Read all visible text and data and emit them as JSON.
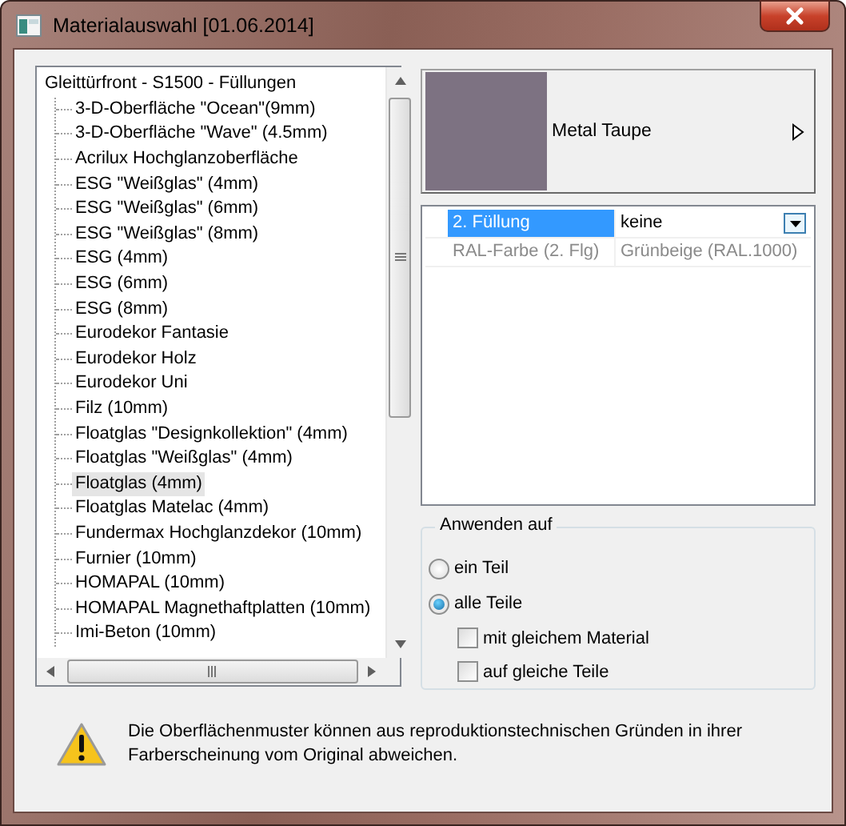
{
  "window": {
    "title": "Materialauswahl [01.06.2014]"
  },
  "tree": {
    "root": "Gleittürfront - S1500 - Füllungen",
    "children": [
      {
        "label": "3-D-Oberfläche \"Ocean\"(9mm)",
        "selected": false
      },
      {
        "label": "3-D-Oberfläche \"Wave\" (4.5mm)",
        "selected": false
      },
      {
        "label": "Acrilux Hochglanzoberfläche",
        "selected": false
      },
      {
        "label": "ESG \"Weißglas\" (4mm)",
        "selected": false
      },
      {
        "label": "ESG \"Weißglas\" (6mm)",
        "selected": false
      },
      {
        "label": "ESG \"Weißglas\" (8mm)",
        "selected": false
      },
      {
        "label": "ESG (4mm)",
        "selected": false
      },
      {
        "label": "ESG (6mm)",
        "selected": false
      },
      {
        "label": "ESG (8mm)",
        "selected": false
      },
      {
        "label": "Eurodekor Fantasie",
        "selected": false
      },
      {
        "label": "Eurodekor Holz",
        "selected": false
      },
      {
        "label": "Eurodekor Uni",
        "selected": false
      },
      {
        "label": "Filz (10mm)",
        "selected": false
      },
      {
        "label": "Floatglas \"Designkollektion\" (4mm)",
        "selected": false
      },
      {
        "label": "Floatglas \"Weißglas\" (4mm)",
        "selected": false
      },
      {
        "label": "Floatglas (4mm)",
        "selected": true
      },
      {
        "label": "Floatglas Matelac (4mm)",
        "selected": false
      },
      {
        "label": "Fundermax Hochglanzdekor (10mm)",
        "selected": false
      },
      {
        "label": "Furnier (10mm)",
        "selected": false
      },
      {
        "label": "HOMAPAL (10mm)",
        "selected": false
      },
      {
        "label": "HOMAPAL Magnethaftplatten (10mm)",
        "selected": false
      },
      {
        "label": "Imi-Beton (10mm)",
        "selected": false
      }
    ]
  },
  "material": {
    "name": "Metal Taupe",
    "color": "#7d7282"
  },
  "properties": [
    {
      "name": "2. Füllung",
      "value": "keine",
      "kind": "dropdown",
      "selected": true,
      "disabled": false
    },
    {
      "name": "RAL-Farbe (2. Flg)",
      "value": "Grünbeige (RAL.1000)",
      "kind": "text",
      "selected": false,
      "disabled": true
    }
  ],
  "apply": {
    "title": "Anwenden auf",
    "options": [
      {
        "label": "ein Teil",
        "kind": "radio",
        "selected": false
      },
      {
        "label": "alle Teile",
        "kind": "radio",
        "selected": true
      },
      {
        "label": "mit gleichem Material",
        "kind": "checkbox",
        "checked": false
      },
      {
        "label": "auf gleiche Teile",
        "kind": "checkbox",
        "checked": false
      }
    ]
  },
  "warning": "Die Oberflächenmuster können aus reproduktionstechnischen Gründen in ihrer Farberscheinung vom Original abweichen."
}
